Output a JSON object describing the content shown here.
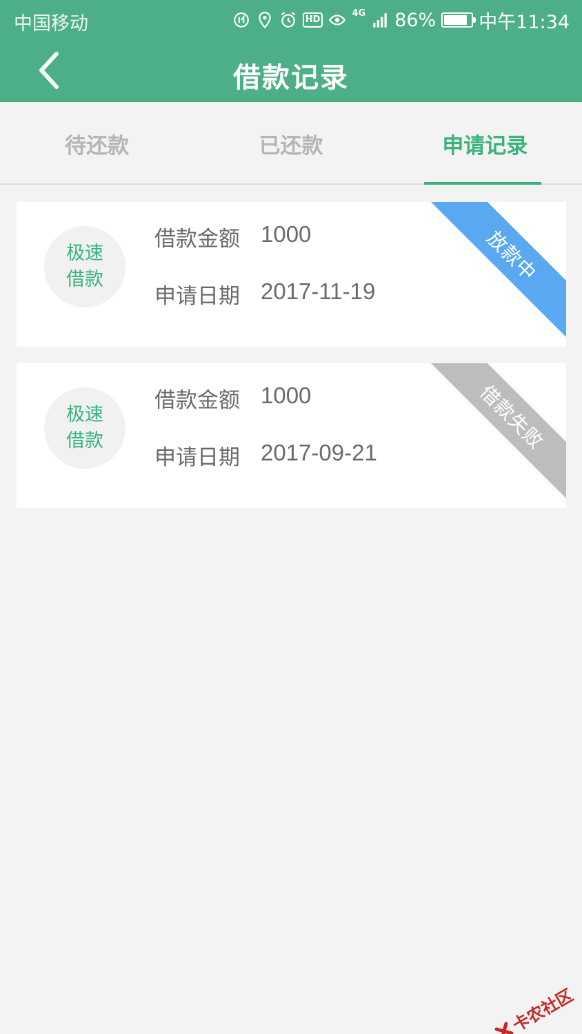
{
  "status": {
    "carrier": "中国移动",
    "network": "4G",
    "battery": "86%",
    "battery_level": 0.86,
    "time": "中午11:34"
  },
  "header": {
    "title": "借款记录"
  },
  "tabs": [
    {
      "label": "待还款",
      "active": false
    },
    {
      "label": "已还款",
      "active": false
    },
    {
      "label": "申请记录",
      "active": true
    }
  ],
  "records": [
    {
      "badge_line1": "极速",
      "badge_line2": "借款",
      "amount_label": "借款金额",
      "amount": "1000",
      "date_label": "申请日期",
      "date": "2017-11-19",
      "status": "放款中",
      "status_color": "#5aa9f0"
    },
    {
      "badge_line1": "极速",
      "badge_line2": "借款",
      "amount_label": "借款金额",
      "amount": "1000",
      "date_label": "申请日期",
      "date": "2017-09-21",
      "status": "借款失败",
      "status_color": "#bdbdbd"
    }
  ],
  "watermark": "卡农社区",
  "colors": {
    "primary": "#4caf87",
    "accent": "#39b37e"
  }
}
